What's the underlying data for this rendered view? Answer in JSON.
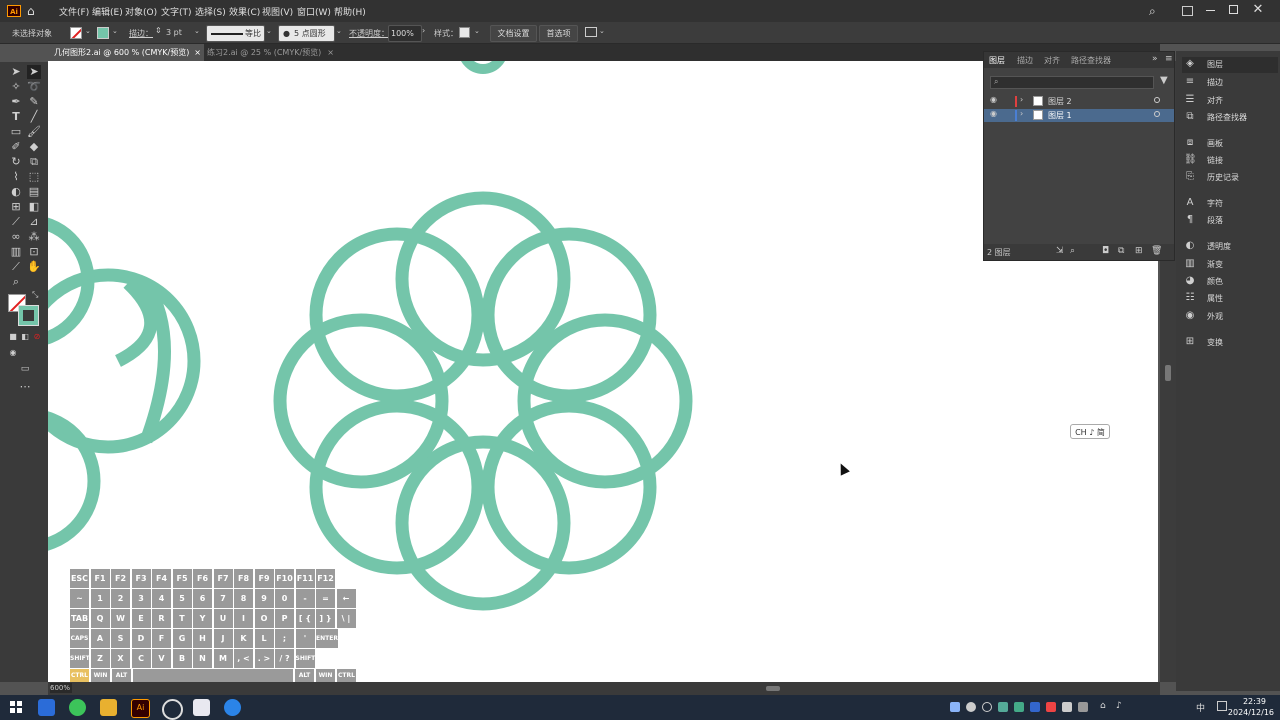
{
  "app": {
    "logo": "Ai"
  },
  "menu": {
    "items": [
      "文件(F)",
      "编辑(E)",
      "对象(O)",
      "文字(T)",
      "选择(S)",
      "效果(C)",
      "视图(V)",
      "窗口(W)",
      "帮助(H)"
    ]
  },
  "control_bar": {
    "selection_label": "未选择对象",
    "stroke_label": "描边：",
    "stroke_value": "3 pt",
    "stroke_profile": "等比",
    "brush_label": "5 点圆形",
    "opacity_label": "不透明度：",
    "opacity_value": "100%",
    "style_label": "样式：",
    "doc_setup_label": "文档设置",
    "prefs_label": "首选项"
  },
  "tabs": [
    {
      "label": "几何图形2.ai @ 600 % (CMYK/预览)",
      "close": "×",
      "active": true
    },
    {
      "label": "练习2.ai @ 25 % (CMYK/预览)",
      "close": "×",
      "active": false
    }
  ],
  "layers_panel": {
    "tabs": [
      "图层",
      "描边",
      "对齐",
      "路径查找器"
    ],
    "layers": [
      {
        "name": "图层 2",
        "color": "#e04040",
        "selected": false
      },
      {
        "name": "图层 1",
        "color": "#4a7fd4",
        "selected": true
      }
    ],
    "footer_count": "2 图层"
  },
  "dock": {
    "items": [
      {
        "label": "图层",
        "icon": "layers-icon"
      },
      {
        "label": "描边",
        "icon": "stroke-icon"
      },
      {
        "label": "对齐",
        "icon": "align-icon"
      },
      {
        "label": "路径查找器",
        "icon": "pathfinder-icon"
      },
      {
        "label": "画板",
        "icon": "artboard-icon"
      },
      {
        "label": "链接",
        "icon": "link-icon"
      },
      {
        "label": "历史记录",
        "icon": "history-icon"
      },
      {
        "label": "字符",
        "icon": "character-icon"
      },
      {
        "label": "段落",
        "icon": "paragraph-icon"
      },
      {
        "label": "透明度",
        "icon": "transparency-icon"
      },
      {
        "label": "渐变",
        "icon": "gradient-icon"
      },
      {
        "label": "颜色",
        "icon": "color-icon"
      },
      {
        "label": "属性",
        "icon": "properties-icon"
      },
      {
        "label": "外观",
        "icon": "appearance-icon"
      },
      {
        "label": "变换",
        "icon": "transform-icon"
      }
    ]
  },
  "canvas": {
    "zoom": "600%",
    "ime_badge": "CH ♪ 简",
    "artwork_color": "#74c5aa"
  },
  "keyboard": {
    "row1": [
      "ESC",
      "F1",
      "F2",
      "F3",
      "F4",
      "F5",
      "F6",
      "F7",
      "F8",
      "F9",
      "F10",
      "F11",
      "F12"
    ],
    "row2": [
      "~",
      "1",
      "2",
      "3",
      "4",
      "5",
      "6",
      "7",
      "8",
      "9",
      "0",
      "-",
      "=",
      "←"
    ],
    "row3": [
      "TAB",
      "Q",
      "W",
      "E",
      "R",
      "T",
      "Y",
      "U",
      "I",
      "O",
      "P",
      "[ {",
      "] }",
      "\\ |"
    ],
    "row4": [
      "CAPS",
      "A",
      "S",
      "D",
      "F",
      "G",
      "H",
      "J",
      "K",
      "L",
      ";",
      "'",
      "ENTER"
    ],
    "row5": [
      "SHIFT",
      "Z",
      "X",
      "C",
      "V",
      "B",
      "N",
      "M",
      ", <",
      ". >",
      "/ ?",
      "SHIFT"
    ],
    "row6": [
      "CTRL",
      "WIN",
      "ALT",
      "ALT",
      "WIN",
      "CTRL"
    ]
  },
  "taskbar": {
    "time": "22:39",
    "date": "2024/12/16",
    "ime": "中"
  }
}
